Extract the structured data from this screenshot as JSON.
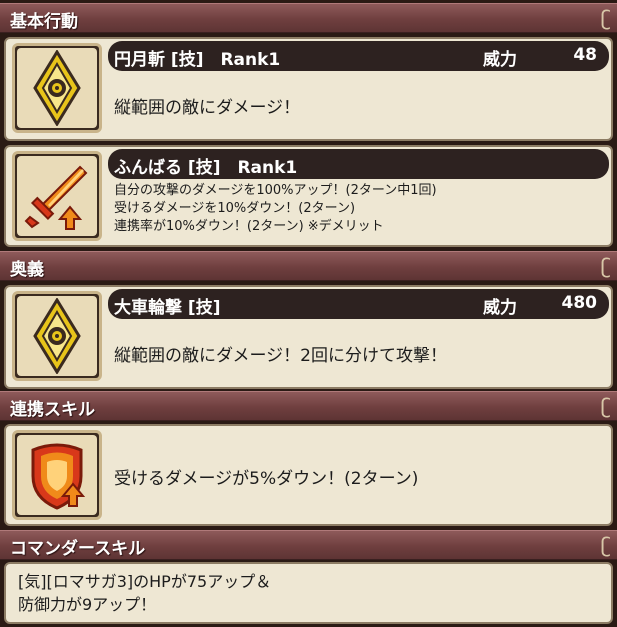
{
  "sections": {
    "basic": "基本行動",
    "ougi": "奥義",
    "renkei": "連携スキル",
    "commander": "コマンダースキル"
  },
  "skills": [
    {
      "name": "円月斬 [技]　Rank1",
      "power_label": "威力",
      "power": "48",
      "desc": "縦範囲の敵にダメージ！",
      "icon": "vertical-eye-icon"
    },
    {
      "name": "ふんばる [技]　Rank1",
      "lines": [
        "自分の攻撃のダメージを100%アップ！(2ターン中1回)",
        "受けるダメージを10%ダウン！(2ターン)",
        "連携率が10%ダウン！(2ターン) ※デメリット"
      ],
      "icon": "sword-up-icon"
    },
    {
      "name": "大車輪撃 [技]",
      "power_label": "威力",
      "power": "480",
      "desc": "縦範囲の敵にダメージ！2回に分けて攻撃！",
      "icon": "vertical-eye-icon"
    },
    {
      "desc": "受けるダメージが5%ダウン！(2ターン)",
      "icon": "shield-up-icon"
    }
  ],
  "commander": {
    "line1": "[気][ロマサガ3]のHPが75アップ＆",
    "line2": "防御力が9アップ！"
  },
  "colors": {
    "accent_gold": "#e8c41a",
    "red": "#d8381a",
    "orange": "#f08a1a"
  }
}
